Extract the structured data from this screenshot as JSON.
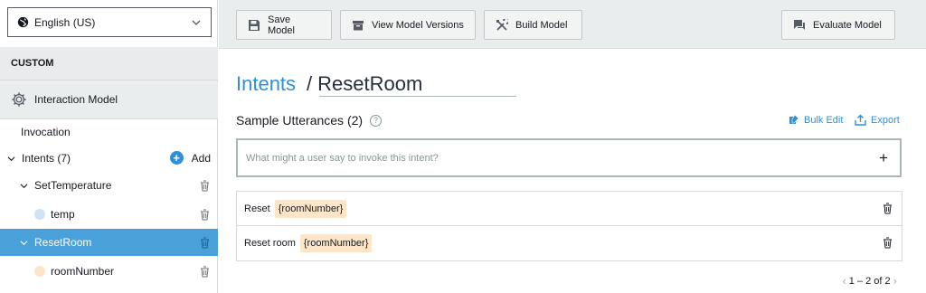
{
  "locale": {
    "label": "English (US)",
    "globe_icon": "globe-icon",
    "chevron_icon": "chevron-down-icon"
  },
  "sidebar": {
    "section_header": "CUSTOM",
    "interaction_model": "Interaction Model",
    "invocation": "Invocation",
    "intents_label": "Intents (7)",
    "add_label": "Add",
    "items": [
      {
        "label": "SetTemperature",
        "type": "intent"
      },
      {
        "label": "temp",
        "type": "slot",
        "dot_color": "#cfe3f5"
      },
      {
        "label": "ResetRoom",
        "type": "intent",
        "active": true
      },
      {
        "label": "roomNumber",
        "type": "slot",
        "dot_color": "#fde6c8"
      }
    ]
  },
  "toolbar": {
    "save": "Save Model",
    "versions": "View Model Versions",
    "build": "Build Model",
    "evaluate": "Evaluate Model"
  },
  "breadcrumb": {
    "parent": "Intents",
    "sep": "/",
    "current": "ResetRoom"
  },
  "utterances": {
    "title": "Sample Utterances (2)",
    "help": "?",
    "bulk_edit": "Bulk Edit",
    "export": "Export",
    "placeholder": "What might a user say to invoke this intent?",
    "add_symbol": "+",
    "rows": [
      {
        "text": "Reset",
        "slot": "{roomNumber}"
      },
      {
        "text": "Reset room",
        "slot": "{roomNumber}"
      }
    ],
    "pager": "1 – 2 of 2"
  },
  "colors": {
    "accent": "#2e90d9",
    "active_row": "#4aa0d9",
    "slot_bg": "#fde6c8"
  }
}
